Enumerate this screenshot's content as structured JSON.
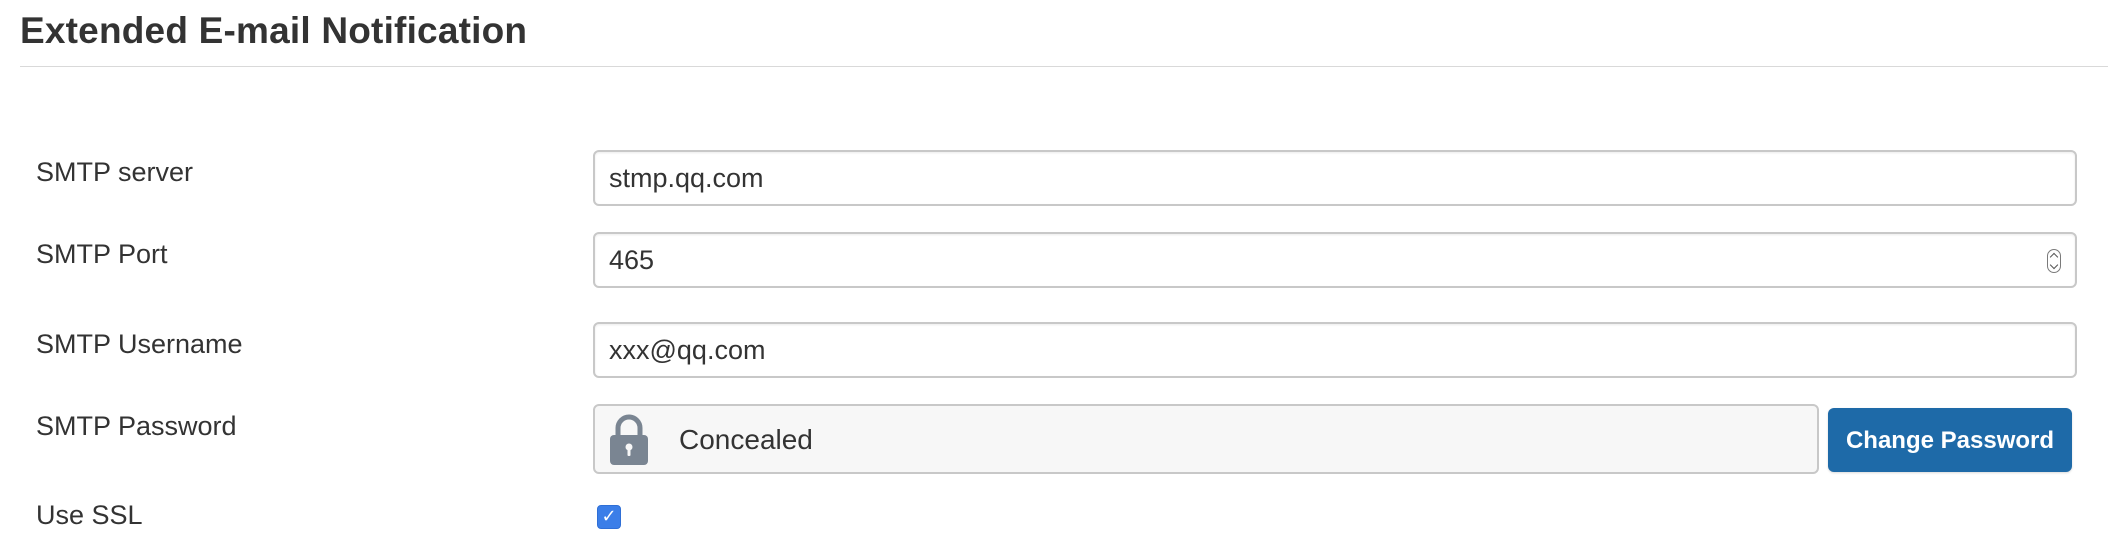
{
  "section": {
    "title": "Extended E-mail Notification"
  },
  "fields": {
    "smtp_server": {
      "label": "SMTP server",
      "value": "stmp.qq.com"
    },
    "smtp_port": {
      "label": "SMTP Port",
      "value": "465"
    },
    "smtp_username": {
      "label": "SMTP Username",
      "value": "xxx@qq.com"
    },
    "smtp_password": {
      "label": "SMTP Password",
      "status": "Concealed",
      "button_label": "Change Password",
      "icon": "lock-icon"
    },
    "use_ssl": {
      "label": "Use SSL",
      "checked": true,
      "check_glyph": "✓"
    }
  },
  "colors": {
    "button_bg": "#1e6aa8",
    "checkbox_bg": "#3b7ee8",
    "lock_icon": "#7a8592"
  }
}
